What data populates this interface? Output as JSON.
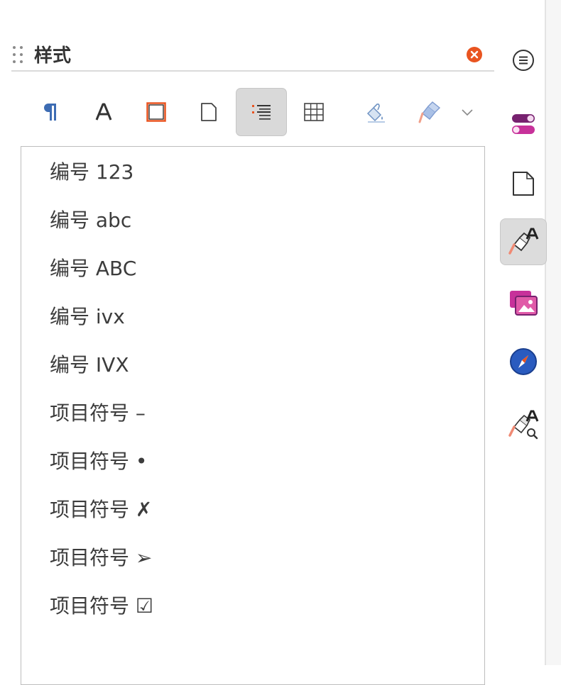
{
  "panel": {
    "title": "样式",
    "close_label": "close"
  },
  "toolbar": {
    "buttons": [
      {
        "name": "paragraph-styles-icon",
        "active": false
      },
      {
        "name": "character-styles-icon",
        "active": false
      },
      {
        "name": "frame-styles-icon",
        "active": false
      },
      {
        "name": "page-styles-icon",
        "active": false
      },
      {
        "name": "list-styles-icon",
        "active": true
      },
      {
        "name": "table-styles-icon",
        "active": false
      },
      {
        "name": "fill-format-mode-icon",
        "active": false
      },
      {
        "name": "styles-actions-icon",
        "active": false
      },
      {
        "name": "chevron-down-icon",
        "active": false
      }
    ]
  },
  "list_styles": [
    "编号 123",
    "编号 abc",
    "编号 ABC",
    "编号 ivx",
    "编号 IVX",
    "项目符号 –",
    "项目符号 •",
    "项目符号 ✗",
    "项目符号 ➢",
    "项目符号 ☑"
  ],
  "deck": {
    "buttons": [
      {
        "name": "sidebar-settings-icon",
        "active": false
      },
      {
        "name": "properties-icon",
        "active": false
      },
      {
        "name": "page-icon",
        "active": false
      },
      {
        "name": "styles-icon",
        "active": true
      },
      {
        "name": "gallery-icon",
        "active": false
      },
      {
        "name": "navigator-icon",
        "active": false
      },
      {
        "name": "style-inspector-icon",
        "active": false
      }
    ]
  },
  "colors": {
    "accent": "#e95420",
    "purple": "#77216f",
    "magenta": "#c7319a",
    "navigator_blue": "#2a5bbf"
  }
}
